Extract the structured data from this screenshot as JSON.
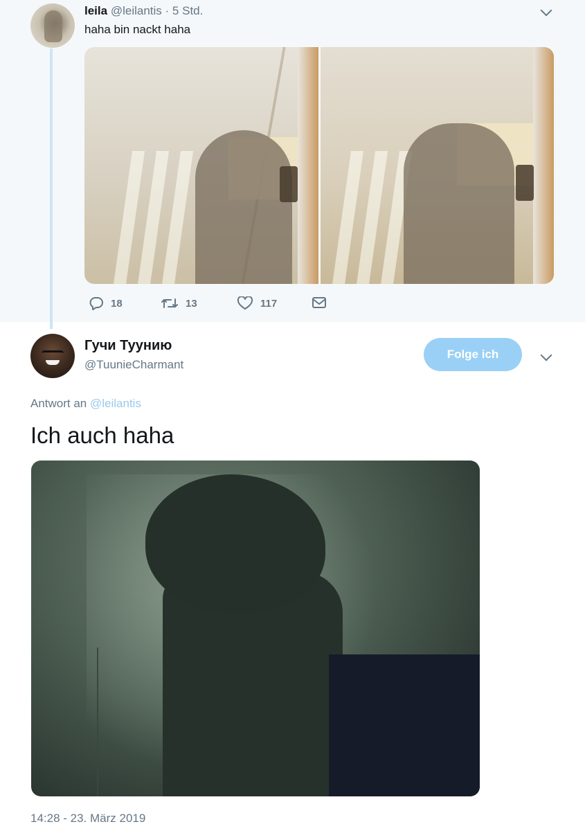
{
  "quoted_tweet": {
    "name": "leila",
    "handle": "@leilantis",
    "separator": "·",
    "time": "5 Std.",
    "text": "haha bin nackt haha",
    "stats": {
      "replies": "18",
      "retweets": "13",
      "likes": "117"
    }
  },
  "reply_tweet": {
    "name": "Гучи Туунию",
    "handle": "@TuunieCharmant",
    "follow_label": "Folge ich",
    "reply_to_prefix": "Antwort an",
    "reply_to_mention": "@leilantis",
    "text": "Ich auch haha",
    "timestamp": "14:28 - 23. März 2019"
  },
  "colors": {
    "accent": "#1da1f2",
    "follow_button_bg": "#9ad0f5",
    "muted_text": "#657786",
    "quoted_bg": "#f5f8fa",
    "thread_line": "#cce4f7"
  },
  "icons": {
    "reply": "reply-icon",
    "retweet": "retweet-icon",
    "like": "heart-icon",
    "dm": "envelope-icon",
    "menu": "chevron-down-icon"
  }
}
